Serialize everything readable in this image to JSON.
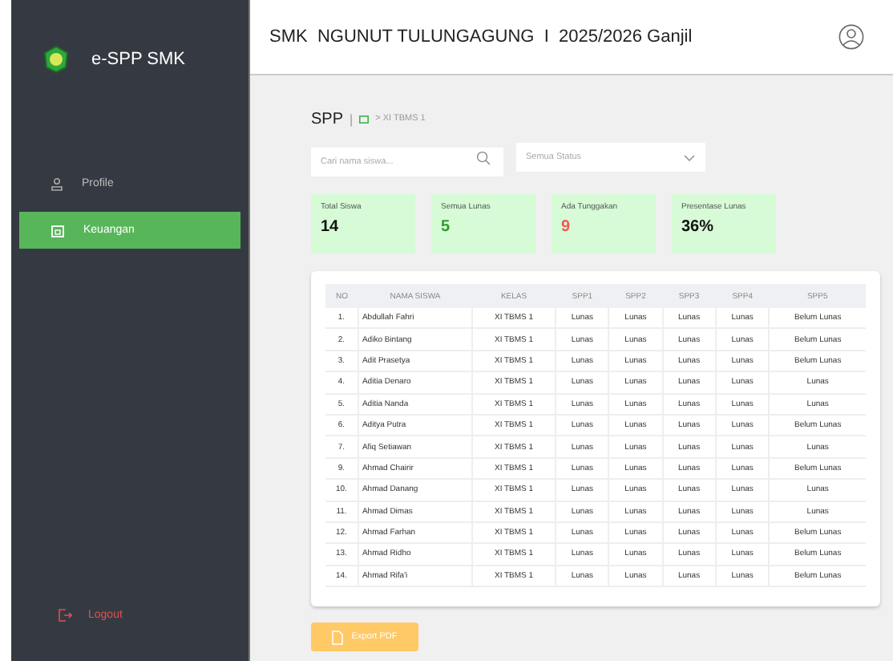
{
  "sidebar": {
    "brand": "e-SPP SMK",
    "items": [
      {
        "label": "Profile",
        "kind": "profile",
        "selected": false
      },
      {
        "label": "Keuangan",
        "kind": "finance",
        "selected": true
      }
    ],
    "logout": "Logout"
  },
  "header": {
    "title": "SMK  NGUNUT TULUNGAGUNG  I  2025/2026 Ganjil"
  },
  "page": {
    "title": "SPP",
    "separator": "|",
    "breadcrumb": "> XI TBMS 1"
  },
  "search": {
    "placeholder": "Cari nama siswa..."
  },
  "status_filter": {
    "value": "Semua Status"
  },
  "stats": [
    {
      "label": "Total Siswa",
      "value": "14",
      "color": "#111111"
    },
    {
      "label": "Semua Lunas",
      "value": "5",
      "color": "#2e9e2e"
    },
    {
      "label": "Ada Tunggakan",
      "value": "9",
      "color": "#f05a5a"
    },
    {
      "label": "Presentase Lunas",
      "value": "36%",
      "color": "#111111"
    }
  ],
  "table": {
    "columns": [
      "NO",
      "NAMA SISWA",
      "KELAS",
      "SPP1",
      "SPP2",
      "SPP3",
      "SPP4",
      "SPP5"
    ],
    "rows": [
      [
        "1.",
        "Abdullah Fahri",
        "XI TBMS 1",
        "Lunas",
        "Lunas",
        "Lunas",
        "Lunas",
        "Belum Lunas"
      ],
      [
        "2.",
        "Adiko Bintang",
        "XI TBMS 1",
        "Lunas",
        "Lunas",
        "Lunas",
        "Lunas",
        "Belum Lunas"
      ],
      [
        "3.",
        "Adit Prasetya",
        "XI TBMS 1",
        "Lunas",
        "Lunas",
        "Lunas",
        "Lunas",
        "Belum Lunas"
      ],
      [
        "4.",
        "Aditia Denaro",
        "XI TBMS 1",
        "Lunas",
        "Lunas",
        "Lunas",
        "Lunas",
        "Lunas"
      ],
      [
        "5.",
        "Aditia Nanda",
        "XI TBMS 1",
        "Lunas",
        "Lunas",
        "Lunas",
        "Lunas",
        "Lunas"
      ],
      [
        "6.",
        "Aditya Putra",
        "XI TBMS 1",
        "Lunas",
        "Lunas",
        "Lunas",
        "Lunas",
        "Belum Lunas"
      ],
      [
        "7.",
        "Afiq Setiawan",
        "XI TBMS 1",
        "Lunas",
        "Lunas",
        "Lunas",
        "Lunas",
        "Lunas"
      ],
      [
        "9.",
        "Ahmad Chairir",
        "XI TBMS 1",
        "Lunas",
        "Lunas",
        "Lunas",
        "Lunas",
        "Belum Lunas"
      ],
      [
        "10.",
        "Ahmad Danang",
        "XI TBMS 1",
        "Lunas",
        "Lunas",
        "Lunas",
        "Lunas",
        "Lunas"
      ],
      [
        "11.",
        "Ahmad Dimas",
        "XI TBMS 1",
        "Lunas",
        "Lunas",
        "Lunas",
        "Lunas",
        "Lunas"
      ],
      [
        "12.",
        "Ahmad Farhan",
        "XI TBMS 1",
        "Lunas",
        "Lunas",
        "Lunas",
        "Lunas",
        "Belum Lunas"
      ],
      [
        "13.",
        "Ahmad Ridho",
        "XI TBMS 1",
        "Lunas",
        "Lunas",
        "Lunas",
        "Lunas",
        "Belum Lunas"
      ],
      [
        "14.",
        "Ahmad Rifa'i",
        "XI TBMS 1",
        "Lunas",
        "Lunas",
        "Lunas",
        "Lunas",
        "Belum Lunas"
      ]
    ]
  },
  "export_button": "Export PDF"
}
